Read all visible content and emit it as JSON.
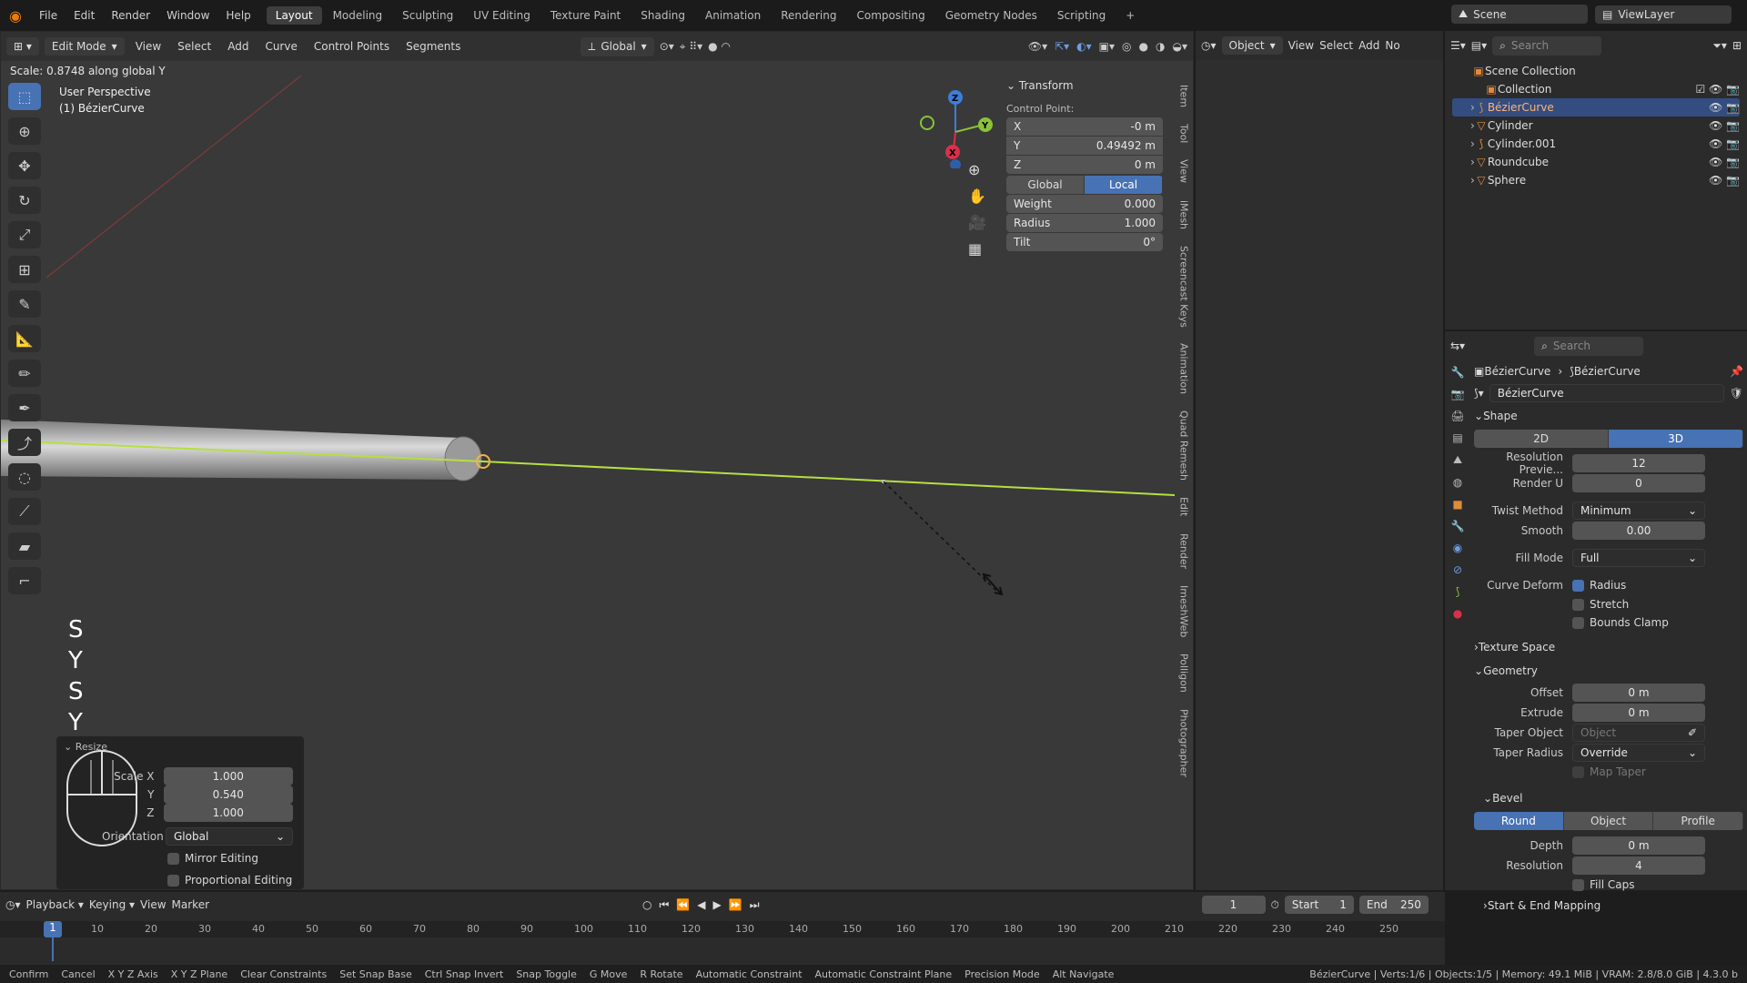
{
  "topbar": {
    "menus": [
      "File",
      "Edit",
      "Render",
      "Window",
      "Help"
    ],
    "workspaces": [
      "Layout",
      "Modeling",
      "Sculpting",
      "UV Editing",
      "Texture Paint",
      "Shading",
      "Animation",
      "Rendering",
      "Compositing",
      "Geometry Nodes",
      "Scripting"
    ],
    "active_workspace": "Layout",
    "scene": "Scene",
    "viewlayer": "ViewLayer"
  },
  "viewport_header": {
    "mode": "Edit Mode",
    "menus": [
      "View",
      "Select",
      "Add",
      "Curve",
      "Control Points",
      "Segments"
    ],
    "orientation": "Global",
    "info": "Scale: 0.8748 along global Y"
  },
  "overlay": {
    "perspective": "User Perspective",
    "object": "(1) BézierCurve",
    "keys": [
      "S",
      "Y",
      "S",
      "Y"
    ]
  },
  "transform_panel": {
    "title": "Transform",
    "subtitle": "Control Point:",
    "x": "-0 m",
    "y": "0.49492 m",
    "z": "0 m",
    "space_tabs": [
      "Global",
      "Local"
    ],
    "active_space": "Local",
    "weight": "0.000",
    "radius": "1.000",
    "tilt": "0°",
    "labels": {
      "x": "X",
      "y": "Y",
      "z": "Z",
      "weight": "Weight",
      "radius": "Radius",
      "tilt": "Tilt"
    }
  },
  "sidebar_tabs": [
    "Item",
    "Tool",
    "View",
    "iMesh",
    "Screencast Keys",
    "Animation",
    "Quad Remesh",
    "Edit",
    "Render",
    "ImeshWeb",
    "Polligon",
    "Photographer"
  ],
  "resize_panel": {
    "title": "Resize",
    "scale_x": "1.000",
    "scale_y": "0.540",
    "scale_z": "1.000",
    "orientation": "Global",
    "mirror": "Mirror Editing",
    "proportional": "Proportional Editing",
    "labels": {
      "scale_x": "Scale X",
      "y": "Y",
      "z": "Z",
      "orientation": "Orientation"
    }
  },
  "right_header": {
    "mode": "Object",
    "menus": [
      "View",
      "Select",
      "Add",
      "No"
    ]
  },
  "outliner": {
    "search": "Search",
    "root": "Scene Collection",
    "collection": "Collection",
    "items": [
      {
        "name": "BézierCurve",
        "selected": true
      },
      {
        "name": "Cylinder"
      },
      {
        "name": "Cylinder.001"
      },
      {
        "name": "Roundcube"
      },
      {
        "name": "Sphere"
      }
    ]
  },
  "properties": {
    "search": "Search",
    "breadcrumb": [
      "BézierCurve",
      "BézierCurve"
    ],
    "datablock": "BézierCurve",
    "shape": {
      "title": "Shape",
      "tabs": [
        "2D",
        "3D"
      ],
      "active": "3D",
      "resolution_preview_label": "Resolution Previe...",
      "resolution_preview": "12",
      "render_u_label": "Render U",
      "render_u": "0",
      "twist_method_label": "Twist Method",
      "twist_method": "Minimum",
      "smooth_label": "Smooth",
      "smooth": "0.00",
      "fill_mode_label": "Fill Mode",
      "fill_mode": "Full",
      "curve_deform_label": "Curve Deform",
      "radius": "Radius",
      "stretch": "Stretch",
      "bounds_clamp": "Bounds Clamp"
    },
    "texture_space": "Texture Space",
    "geometry": {
      "title": "Geometry",
      "offset_label": "Offset",
      "offset": "0 m",
      "extrude_label": "Extrude",
      "extrude": "0 m",
      "taper_object_label": "Taper Object",
      "taper_object": "Object",
      "taper_radius_label": "Taper Radius",
      "taper_radius": "Override",
      "map_taper": "Map Taper"
    },
    "bevel": {
      "title": "Bevel",
      "tabs": [
        "Round",
        "Object",
        "Profile"
      ],
      "active": "Round",
      "depth_label": "Depth",
      "depth": "0 m",
      "resolution_label": "Resolution",
      "resolution": "4",
      "fill_caps": "Fill Caps"
    },
    "start_end": "Start & End Mapping"
  },
  "timeline": {
    "menus": [
      "Playback",
      "Keying",
      "View",
      "Marker"
    ],
    "current_frame": "1",
    "start_label": "Start",
    "start": "1",
    "end_label": "End",
    "end": "250",
    "ticks": [
      "1",
      "10",
      "20",
      "30",
      "40",
      "50",
      "60",
      "70",
      "80",
      "90",
      "100",
      "110",
      "120",
      "130",
      "140",
      "150",
      "160",
      "170",
      "180",
      "190",
      "200",
      "210",
      "220",
      "230",
      "240",
      "250"
    ]
  },
  "statusbar": {
    "items": [
      "Confirm",
      "Cancel",
      "X Y Z Axis",
      "X Y Z Plane",
      "Clear Constraints",
      "Set Snap Base",
      "Ctrl Snap Invert",
      "Snap Toggle",
      "G Move",
      "R Rotate",
      "Automatic Constraint",
      "Automatic Constraint Plane",
      "Precision Mode",
      "Alt Navigate"
    ],
    "right": "BézierCurve | Verts:1/6 | Objects:1/5 | Memory: 49.1 MiB | VRAM: 2.8/8.0 GiB | 4.3.0 b"
  }
}
